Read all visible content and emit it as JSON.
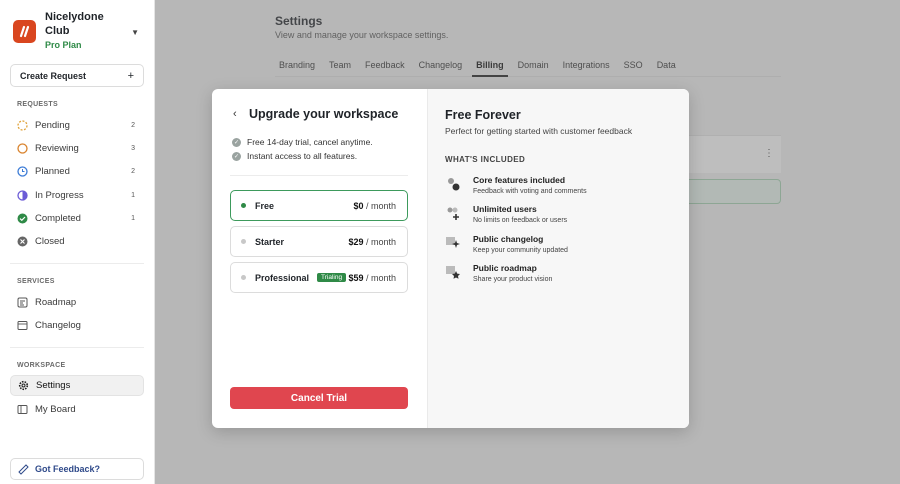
{
  "org": {
    "name": "Nicelydone Club",
    "plan": "Pro Plan"
  },
  "sidebar": {
    "create_label": "Create Request",
    "requests_label": "REQUESTS",
    "requests": [
      {
        "label": "Pending",
        "count": "2",
        "icon": "pending-icon",
        "color": "#e0a33a"
      },
      {
        "label": "Reviewing",
        "count": "3",
        "icon": "reviewing-icon",
        "color": "#d9822b"
      },
      {
        "label": "Planned",
        "count": "2",
        "icon": "planned-icon",
        "color": "#3b7bd6"
      },
      {
        "label": "In Progress",
        "count": "1",
        "icon": "in-progress-icon",
        "color": "#6b5bd6"
      },
      {
        "label": "Completed",
        "count": "1",
        "icon": "completed-icon",
        "color": "#2f8a47"
      },
      {
        "label": "Closed",
        "count": "",
        "icon": "closed-icon",
        "color": "#666666"
      }
    ],
    "services_label": "SERVICES",
    "services": [
      {
        "label": "Roadmap"
      },
      {
        "label": "Changelog"
      }
    ],
    "workspace_label": "WORKSPACE",
    "workspace": [
      {
        "label": "Settings"
      },
      {
        "label": "My Board"
      }
    ],
    "feedback_label": "Got Feedback?"
  },
  "main": {
    "title": "Settings",
    "subtitle": "View and manage your workspace settings.",
    "tabs": [
      "Branding",
      "Team",
      "Feedback",
      "Changelog",
      "Billing",
      "Domain",
      "Integrations",
      "SSO",
      "Data"
    ],
    "active_tab": "Billing"
  },
  "modal": {
    "title": "Upgrade your workspace",
    "checks": [
      "Free 14-day trial, cancel anytime.",
      "Instant access to all features."
    ],
    "plans": [
      {
        "name": "Free",
        "price": "$0",
        "period": " / month",
        "badge": ""
      },
      {
        "name": "Starter",
        "price": "$29",
        "period": " / month",
        "badge": ""
      },
      {
        "name": "Professional",
        "price": "$59",
        "period": " / month",
        "badge": "Trialing"
      }
    ],
    "cancel_label": "Cancel Trial",
    "detail": {
      "title": "Free Forever",
      "subtitle": "Perfect for getting started with customer feedback",
      "section": "WHAT'S INCLUDED",
      "features": [
        {
          "title": "Core features included",
          "desc": "Feedback with voting and comments"
        },
        {
          "title": "Unlimited users",
          "desc": "No limits on feedback or users"
        },
        {
          "title": "Public changelog",
          "desc": "Keep your community updated"
        },
        {
          "title": "Public roadmap",
          "desc": "Share your product vision"
        }
      ]
    }
  },
  "colors": {
    "accent_green": "#2f8a47",
    "danger": "#e0464f",
    "logo": "#d9461f"
  }
}
